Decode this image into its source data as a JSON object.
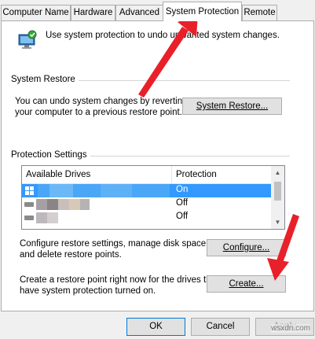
{
  "tabs": [
    "Computer Name",
    "Hardware",
    "Advanced",
    "System Protection",
    "Remote"
  ],
  "intro_text": "Use system protection to undo unwanted system changes.",
  "system_restore": {
    "group_label": "System Restore",
    "description_line1": "You can undo system changes by reverting",
    "description_line2": "your computer to a previous restore point.",
    "button_label": "System Restore..."
  },
  "protection_settings": {
    "group_label": "Protection Settings",
    "columns": [
      "Available Drives",
      "Protection"
    ],
    "rows": [
      {
        "protection": "On",
        "selected": true
      },
      {
        "protection": "Off",
        "selected": false
      },
      {
        "protection": "Off",
        "selected": false
      }
    ]
  },
  "configure": {
    "description_line1": "Configure restore settings, manage disk space,",
    "description_line2": "and delete restore points.",
    "button_label": "Configure..."
  },
  "create": {
    "description_line1": "Create a restore point right now for the drives that",
    "description_line2": "have system protection turned on.",
    "button_label": "Create..."
  },
  "footer": {
    "ok_label": "OK",
    "cancel_label": "Cancel",
    "apply_label": "Apply",
    "watermark": "wsxdn.com"
  },
  "colors": {
    "selection": "#3399ff",
    "arrow": "#e8202a"
  }
}
